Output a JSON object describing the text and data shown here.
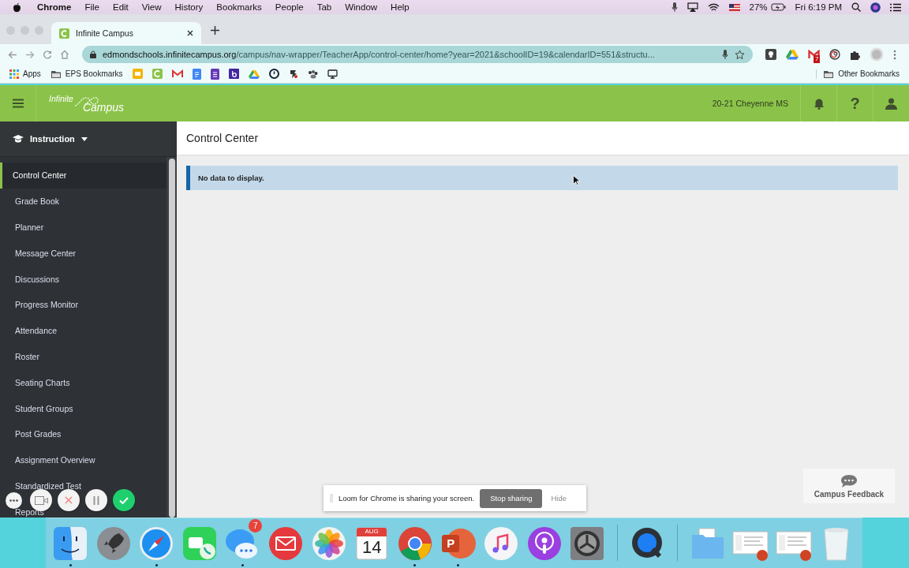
{
  "menubar": {
    "app": "Chrome",
    "menus": [
      "File",
      "Edit",
      "View",
      "History",
      "Bookmarks",
      "People",
      "Tab",
      "Window",
      "Help"
    ],
    "battery": "27%",
    "clock": "Fri 6:19 PM"
  },
  "browser": {
    "tabs": [
      {
        "title": "Infinite Campus",
        "selected": true
      }
    ],
    "url": {
      "host": "edmondschools.infinitecampus.org",
      "path": "/campus/nav-wrapper/TeacherApp/control-center/home?year=2021&schoolID=19&calendarID=551&structu..."
    },
    "extensions": [
      {
        "kind": "keep"
      },
      {
        "kind": "drive"
      },
      {
        "kind": "gmail",
        "badge": "7"
      },
      {
        "kind": "spiral"
      },
      {
        "kind": "puzzle"
      },
      {
        "kind": "avatar"
      }
    ],
    "bookmarks": [
      {
        "kind": "apps",
        "label": "Apps"
      },
      {
        "kind": "folder",
        "label": "EPS Bookmarks"
      },
      {
        "kind": "slides"
      },
      {
        "kind": "classroom"
      },
      {
        "kind": "gmail"
      },
      {
        "kind": "docs"
      },
      {
        "kind": "forms"
      },
      {
        "kind": "bold"
      },
      {
        "kind": "drive"
      },
      {
        "kind": "clock"
      },
      {
        "kind": "tools"
      },
      {
        "kind": "paw"
      },
      {
        "kind": "monitor"
      }
    ],
    "other_bookmarks": "Other Bookmarks"
  },
  "app": {
    "brand": [
      "Infinite",
      "Campus"
    ],
    "school": "20-21 Cheyenne MS",
    "help": "?",
    "module": "Instruction",
    "nav": [
      {
        "label": "Control Center",
        "selected": true
      },
      {
        "label": "Grade Book",
        "selected": false
      },
      {
        "label": "Planner",
        "selected": false
      },
      {
        "label": "Message Center",
        "selected": false
      },
      {
        "label": "Discussions",
        "selected": false
      },
      {
        "label": "Progress Monitor",
        "selected": false
      },
      {
        "label": "Attendance",
        "selected": false
      },
      {
        "label": "Roster",
        "selected": false
      },
      {
        "label": "Seating Charts",
        "selected": false
      },
      {
        "label": "Student Groups",
        "selected": false
      },
      {
        "label": "Post Grades",
        "selected": false
      },
      {
        "label": "Assignment Overview",
        "selected": false
      },
      {
        "label": "Standardized Test",
        "selected": false
      },
      {
        "label": "Reports",
        "selected": false
      }
    ],
    "page_title": "Control Center",
    "alert": "No data to display.",
    "feedback": "Campus Feedback"
  },
  "loom": {
    "message": "Loom for Chrome is sharing your screen.",
    "stop": "Stop sharing",
    "hide": "Hide"
  },
  "dock": [
    {
      "kind": "finder",
      "running": true
    },
    {
      "kind": "launchpad",
      "running": false
    },
    {
      "kind": "safari",
      "running": true
    },
    {
      "kind": "facetime",
      "running": false
    },
    {
      "kind": "messages",
      "running": true,
      "badge": "7"
    },
    {
      "kind": "mail",
      "running": false
    },
    {
      "kind": "photos",
      "running": false
    },
    {
      "kind": "calendar",
      "running": false,
      "month": "AUG",
      "day": "14"
    },
    {
      "kind": "chrome",
      "running": true
    },
    {
      "kind": "powerpoint",
      "running": true,
      "letter": "P"
    },
    {
      "kind": "music",
      "running": false
    },
    {
      "kind": "podcasts",
      "running": false
    },
    {
      "kind": "settings",
      "running": false
    },
    {
      "kind": "separator"
    },
    {
      "kind": "quicktime",
      "running": false
    },
    {
      "kind": "separator"
    },
    {
      "kind": "folder",
      "running": false
    },
    {
      "kind": "document",
      "running": false
    },
    {
      "kind": "document",
      "running": false
    },
    {
      "kind": "trash",
      "running": false
    }
  ]
}
